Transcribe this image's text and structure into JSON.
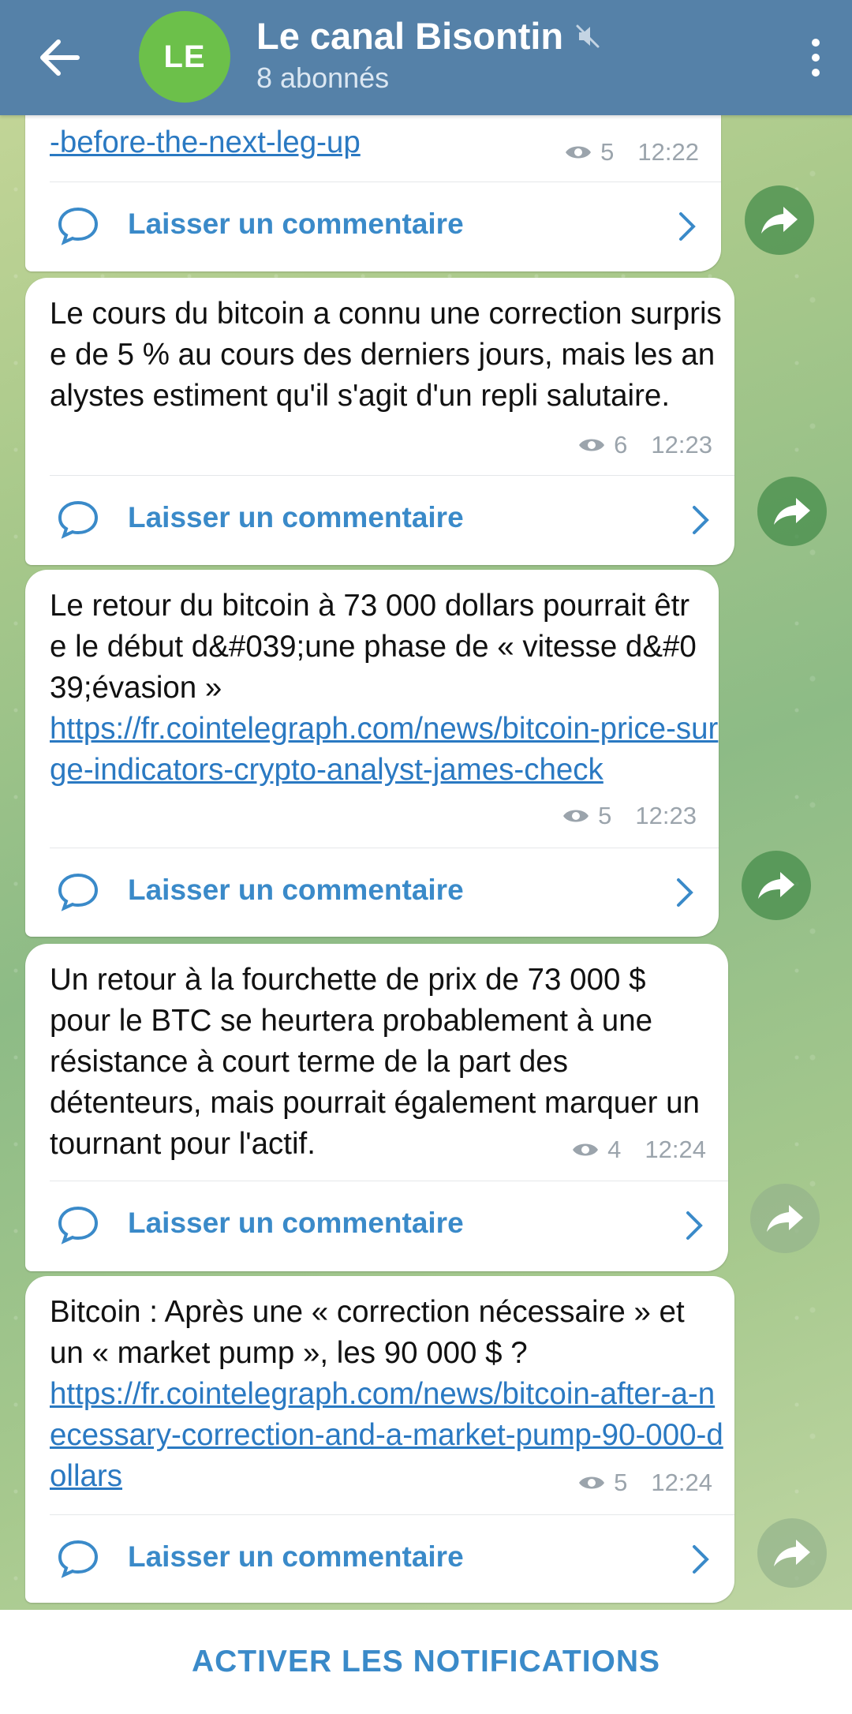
{
  "header": {
    "avatar_initials": "LE",
    "channel_name": "Le canal Bisontin",
    "subscribers": "8 abonnés"
  },
  "messages": [
    {
      "text": "",
      "link": "-before-the-next-leg-up",
      "views": "5",
      "time": "12:22",
      "comment_label": "Laisser un commentaire"
    },
    {
      "text": "Le cours du bitcoin a connu une correction surprise de 5 % au cours des derniers jours, mais les analystes estiment qu'il s'agit d'un repli salutaire.",
      "link": "",
      "views": "6",
      "time": "12:23",
      "comment_label": "Laisser un commentaire"
    },
    {
      "text": "Le retour du bitcoin à 73 000 dollars pourrait être le début d&#039;une phase de « vitesse d&#039;évasion »",
      "link": "https://fr.cointelegraph.com/news/bitcoin-price-surge-indicators-crypto-analyst-james-check",
      "views": "5",
      "time": "12:23",
      "comment_label": "Laisser un commentaire"
    },
    {
      "text": "Un retour à la fourchette de prix de 73 000 $ pour le BTC se heurtera probablement à une résistance à court terme de la part des détenteurs, mais pourrait également marquer un tournant pour l'actif.",
      "link": "",
      "views": "4",
      "time": "12:24",
      "comment_label": "Laisser un commentaire"
    },
    {
      "text": "Bitcoin : Après une « correction nécessaire » et un « market pump », les 90 000 $ ?",
      "link": "https://fr.cointelegraph.com/news/bitcoin-after-a-necessary-correction-and-a-market-pump-90-000-dollars",
      "views": "5",
      "time": "12:24",
      "comment_label": "Laisser un commentaire"
    }
  ],
  "footer": {
    "notifications_button": "ACTIVER LES NOTIFICATIONS"
  }
}
